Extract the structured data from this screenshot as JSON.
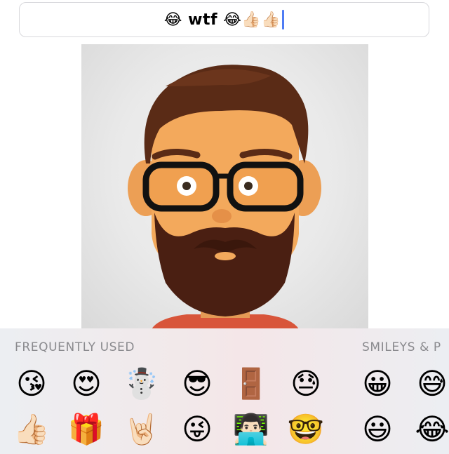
{
  "compose": {
    "text": "😂 wtf 😂👍🏻👍🏻"
  },
  "keyboard": {
    "section_frequent": "FREQUENTLY USED",
    "section_smileys": "SMILEYS & P",
    "frequent_row1": [
      "😘",
      "😍",
      "☃️",
      "😎",
      "🚪",
      "😓"
    ],
    "frequent_row2": [
      "👍🏻",
      "🎁",
      "🤘🏻",
      "😜",
      "👨🏻‍💻",
      "🤓"
    ],
    "smileys_row1": [
      "😀",
      "😅"
    ],
    "smileys_row2": [
      "😃",
      "😂"
    ]
  },
  "colors": {
    "caret": "#4f7cf4",
    "section_label": "#8a8a8e",
    "keyboard_bg": "#eceef2"
  }
}
